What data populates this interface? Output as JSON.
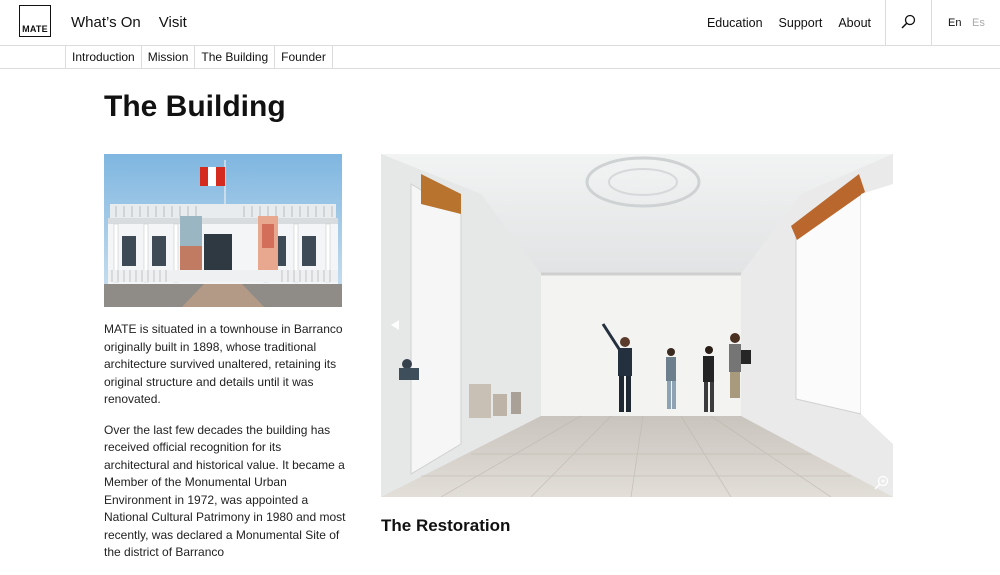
{
  "header": {
    "logo_text": "MATE",
    "nav": [
      "What’s On",
      "Visit"
    ],
    "right_nav": [
      "Education",
      "Support",
      "About"
    ],
    "languages": {
      "en": "En",
      "es": "Es"
    }
  },
  "subnav": [
    "Introduction",
    "Mission",
    "The Building",
    "Founder"
  ],
  "page": {
    "title": "The Building",
    "paragraphs": [
      "MATE is situated in a townhouse in Barranco originally built in 1898, whose traditional architecture survived unaltered, retaining its original structure and details until it was renovated.",
      "Over the last few decades the building has received official recognition for its architectural and historical value. It became a Member of the Monumental Urban Environment in 1972, was appointed a National Cultural Patrimony in 1980 and most recently, was declared a Monumental Site of the district of Barranco"
    ],
    "section_title": "The Restoration"
  },
  "colors": {
    "accent": "#111111",
    "border": "#dcdcdc"
  }
}
